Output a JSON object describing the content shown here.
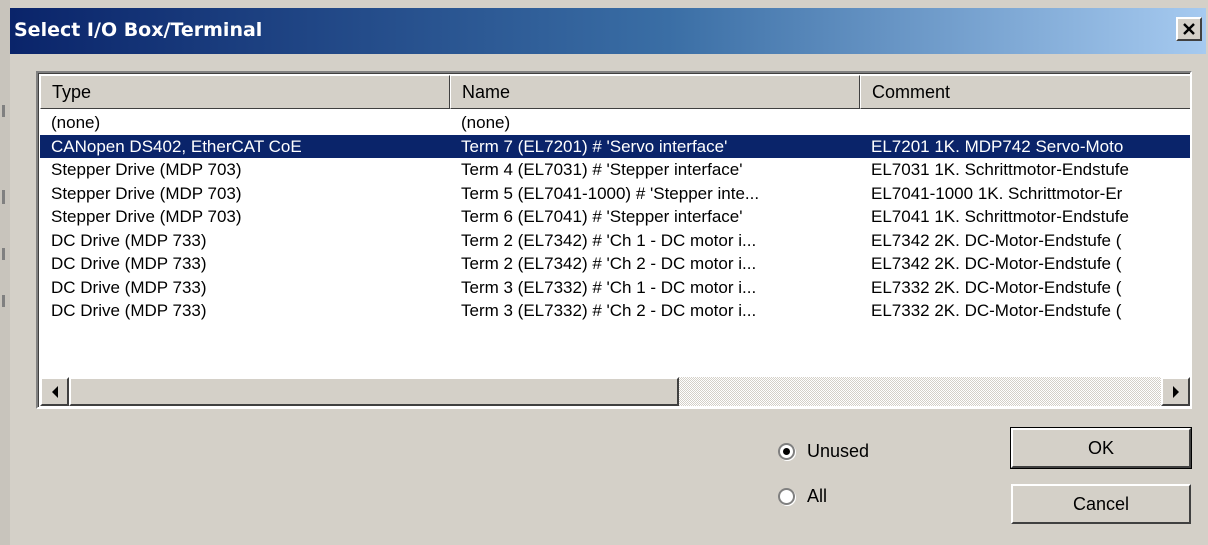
{
  "window": {
    "title": "Select I/O Box/Terminal",
    "close_glyph": "✕"
  },
  "list": {
    "columns": [
      "Type",
      "Name",
      "Comment"
    ],
    "rows": [
      {
        "type": "(none)",
        "name": "(none)",
        "comment": "",
        "selected": false
      },
      {
        "type": "CANopen DS402, EtherCAT CoE",
        "name": "Term 7 (EL7201) # 'Servo interface'",
        "comment": "EL7201 1K. MDP742 Servo-Moto",
        "selected": true
      },
      {
        "type": "Stepper Drive (MDP 703)",
        "name": "Term 4 (EL7031) # 'Stepper interface'",
        "comment": "EL7031 1K. Schrittmotor-Endstufe",
        "selected": false
      },
      {
        "type": "Stepper Drive (MDP 703)",
        "name": "Term 5 (EL7041-1000) # 'Stepper inte...",
        "comment": "EL7041-1000 1K. Schrittmotor-Er",
        "selected": false
      },
      {
        "type": "Stepper Drive (MDP 703)",
        "name": "Term 6 (EL7041) # 'Stepper interface'",
        "comment": "EL7041 1K. Schrittmotor-Endstufe",
        "selected": false
      },
      {
        "type": "DC Drive (MDP 733)",
        "name": "Term 2 (EL7342) # 'Ch 1 - DC motor i...",
        "comment": "EL7342 2K. DC-Motor-Endstufe (",
        "selected": false
      },
      {
        "type": "DC Drive (MDP 733)",
        "name": "Term 2 (EL7342) # 'Ch 2 - DC motor i...",
        "comment": "EL7342 2K. DC-Motor-Endstufe (",
        "selected": false
      },
      {
        "type": "DC Drive (MDP 733)",
        "name": "Term 3 (EL7332) # 'Ch 1 - DC motor i...",
        "comment": "EL7332 2K. DC-Motor-Endstufe (",
        "selected": false
      },
      {
        "type": "DC Drive (MDP 733)",
        "name": "Term 3 (EL7332) # 'Ch 2 - DC motor i...",
        "comment": "EL7332 2K. DC-Motor-Endstufe (",
        "selected": false
      }
    ]
  },
  "scrollbar": {
    "left_arrow_icon": "arrow-left-icon",
    "right_arrow_icon": "arrow-right-icon",
    "position_fraction": 0.0
  },
  "filter": {
    "unused_label": "Unused",
    "all_label": "All",
    "selected": "unused"
  },
  "buttons": {
    "ok_label": "OK",
    "cancel_label": "Cancel"
  }
}
